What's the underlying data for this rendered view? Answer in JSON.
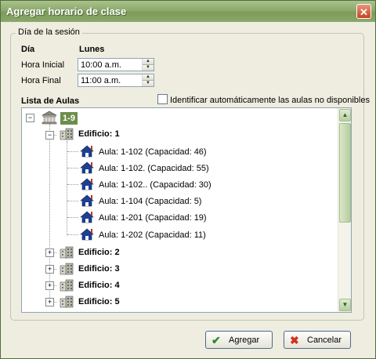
{
  "window": {
    "title": "Agregar horario de clase",
    "close_glyph": "✕"
  },
  "session": {
    "legend": "Día de la sesión",
    "dia_header": "Día",
    "dia_value": "Lunes",
    "hora_inicial_label": "Hora Inicial",
    "hora_inicial_value": "10:00 a.m.",
    "hora_final_label": "Hora Final",
    "hora_final_value": "11:00 a.m."
  },
  "aulas": {
    "label": "Lista de Aulas",
    "auto_checkbox_label": "Identificar automáticamente las aulas no disponibles",
    "auto_checkbox_checked": false
  },
  "tree": {
    "root": {
      "label": "1-9",
      "expanded": true
    },
    "buildings": [
      {
        "label": "Edificio: 1",
        "expanded": true,
        "rooms": [
          {
            "label": "Aula: 1-102  (Capacidad: 46)"
          },
          {
            "label": "Aula: 1-102.  (Capacidad: 55)"
          },
          {
            "label": "Aula: 1-102..  (Capacidad: 30)"
          },
          {
            "label": "Aula: 1-104  (Capacidad: 5)"
          },
          {
            "label": "Aula: 1-201  (Capacidad: 19)"
          },
          {
            "label": "Aula: 1-202  (Capacidad: 11)"
          }
        ]
      },
      {
        "label": "Edificio: 2",
        "expanded": false
      },
      {
        "label": "Edificio: 3",
        "expanded": false
      },
      {
        "label": "Edificio: 4",
        "expanded": false
      },
      {
        "label": "Edificio: 5",
        "expanded": false
      }
    ]
  },
  "buttons": {
    "agregar": "Agregar",
    "cancelar": "Cancelar"
  },
  "icons": {
    "root": "university-icon",
    "building": "building-icon",
    "room": "classroom-house-icon",
    "agregar": "checkmark-icon",
    "cancelar": "x-icon"
  },
  "colors": {
    "title_bar": "#8eaa6c",
    "root_badge": "#6d8e4b",
    "room_icon": "#1f3f8f",
    "check": "#2e8b2e",
    "cancel_x": "#d03020"
  }
}
